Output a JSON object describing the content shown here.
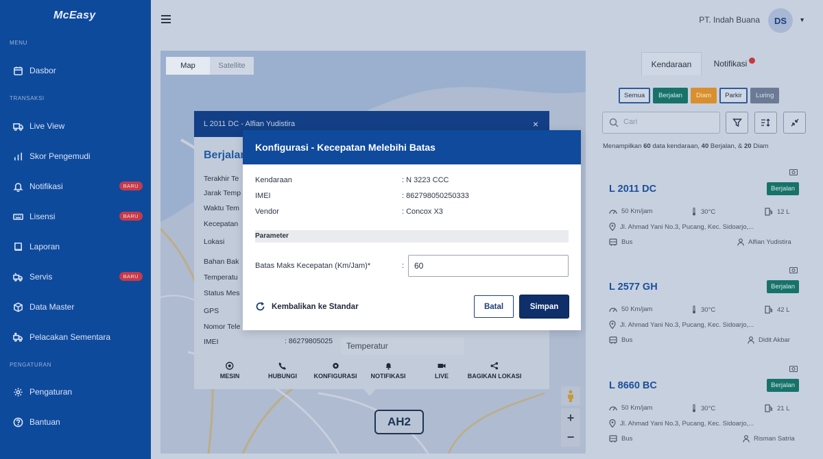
{
  "brand": {
    "logo": "McEasy"
  },
  "sidebar": {
    "sections": {
      "menu": "MENU",
      "transaksi": "TRANSAKSI",
      "pengaturan": "PENGATURAN"
    },
    "items": [
      {
        "label": "Dasbor",
        "icon": "calendar-icon"
      },
      {
        "label": "Live View",
        "icon": "truck-icon"
      },
      {
        "label": "Skor Pengemudi",
        "icon": "bar-chart-icon"
      },
      {
        "label": "Notifikasi",
        "icon": "bell-icon",
        "badge": "BARU"
      },
      {
        "label": "Lisensi",
        "icon": "keyboard-icon",
        "badge": "BARU"
      },
      {
        "label": "Laporan",
        "icon": "book-icon"
      },
      {
        "label": "Servis",
        "icon": "wrench-truck-icon",
        "badge": "BARU"
      },
      {
        "label": "Data Master",
        "icon": "box-icon"
      },
      {
        "label": "Pelacakan Sementara",
        "icon": "tracking-truck-icon"
      },
      {
        "label": "Pengaturan",
        "icon": "gear-icon"
      },
      {
        "label": "Bantuan",
        "icon": "help-icon"
      }
    ]
  },
  "header": {
    "company": "PT. Indah Buana",
    "avatar": "DS"
  },
  "map": {
    "tabs": [
      "Map",
      "Satellite"
    ],
    "road_label": "AH2",
    "zoom_in": "+",
    "zoom_out": "−"
  },
  "popup": {
    "title": "L 2011 DC - Alfian Yudistira",
    "close": "×",
    "status": "Berjalan",
    "labels": [
      "Terakhir Te",
      "Jarak Temp",
      "Waktu Tem",
      "Kecepatan",
      "Lokasi",
      "Bahan Bak",
      "Temperatu",
      "Status Mes",
      "GPS",
      "Nomor Tele",
      "IMEI"
    ],
    "imei_value": ": 86279805025",
    "tooltip": "Temperatur",
    "actions": [
      "MESIN",
      "HUBUNGI",
      "KONFIGURASI",
      "NOTIFIKASI",
      "LIVE",
      "BAGIKAN LOKASI"
    ]
  },
  "panel": {
    "tabs": [
      "Kendaraan",
      "Notifikasi"
    ],
    "chips": [
      "Semua",
      "Berjalan",
      "Diam",
      "Parkir",
      "Luring"
    ],
    "search_placeholder": "Cari",
    "summary": {
      "prefix": "Menampilkan ",
      "total": "60",
      "mid1": " data kendaraan, ",
      "moving": "40",
      "mid2": " Berjalan, & ",
      "idle": "20",
      "suffix": " Diam"
    },
    "cards": [
      {
        "plate": "L 2011 DC",
        "status": "Berjalan",
        "speed": "50 Km/jam",
        "temp": "30°C",
        "fuel": "12 L",
        "address": "Jl. Ahmad Yani No.3, Pucang, Kec. Sidoarjo,...",
        "type": "Bus",
        "driver": "Alfian Yudistira"
      },
      {
        "plate": "L 2577 GH",
        "status": "Berjalan",
        "speed": "50 Km/jam",
        "temp": "30°C",
        "fuel": "42 L",
        "address": "Jl. Ahmad Yani No.3, Pucang, Kec. Sidoarjo,...",
        "type": "Bus",
        "driver": "Didit Akbar"
      },
      {
        "plate": "L 8660 BC",
        "status": "Berjalan",
        "speed": "50 Km/jam",
        "temp": "30°C",
        "fuel": "21 L",
        "address": "Jl. Ahmad Yani No.3, Pucang, Kec. Sidoarjo,...",
        "type": "Bus",
        "driver": "Risman Satria"
      }
    ]
  },
  "modal": {
    "title": "Konfigurasi - Kecepatan Melebihi Batas",
    "fields": [
      {
        "label": "Kendaraan",
        "value": ": N 3223 CCC"
      },
      {
        "label": "IMEI",
        "value": ": 862798050250333"
      },
      {
        "label": "Vendor",
        "value": ": Concox X3"
      }
    ],
    "param_header": "Parameter",
    "speed_label": "Batas Maks Kecepatan (Km/Jam)*",
    "speed_colon": ":",
    "speed_value": "60",
    "reset_label": "Kembalikan ke Standar",
    "cancel_label": "Batal",
    "save_label": "Simpan"
  },
  "colors": {
    "primary": "#0f4a9c",
    "moving": "#17736a",
    "idle": "#d98f2e",
    "offline": "#6c7b95",
    "badge": "#c73a4a"
  }
}
